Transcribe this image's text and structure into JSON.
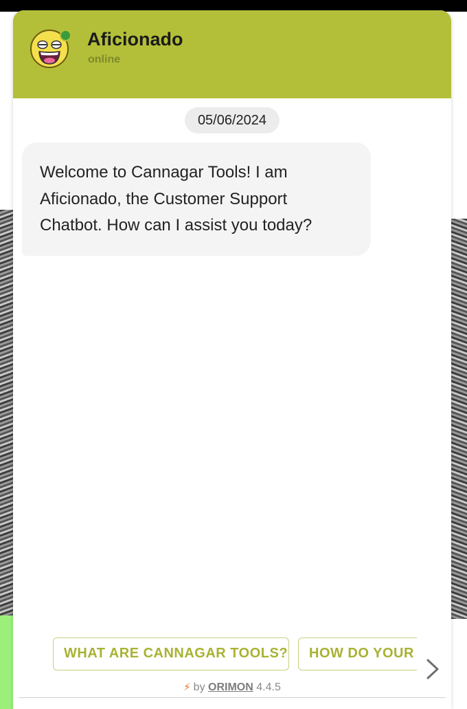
{
  "header": {
    "bot_name": "Aficionado",
    "status": "online",
    "avatar_icon": "laughing-face-icon",
    "online_indicator_color": "#3a9b3a",
    "brand_color": "#b3bf38"
  },
  "chat": {
    "date": "05/06/2024",
    "messages": [
      {
        "sender": "bot",
        "text": "Welcome to Cannagar Tools! I am Aficionado, the Customer Support Chatbot. How can I assist you today?"
      }
    ]
  },
  "suggestions": [
    "WHAT ARE CANNAGAR TOOLS?",
    "HOW DO YOUR T"
  ],
  "scroll_icon": "chevron-right-icon",
  "footer": {
    "bolt_icon": "lightning-icon",
    "by_label": "by",
    "brand_link": "ORIMON",
    "version": "4.4.5"
  }
}
